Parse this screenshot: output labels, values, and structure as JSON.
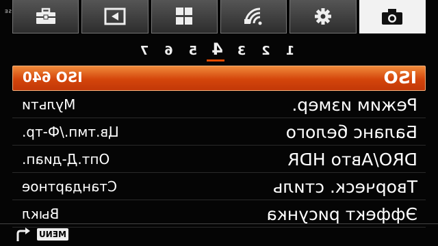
{
  "watermark": "LOVENSE",
  "tabs": [
    {
      "name": "shooting-tab",
      "icon": "camera-icon",
      "active": true
    },
    {
      "name": "custom-tab",
      "icon": "gear-icon",
      "active": false
    },
    {
      "name": "wireless-tab",
      "icon": "wireless-icon",
      "active": false
    },
    {
      "name": "apps-tab",
      "icon": "grid-icon",
      "active": false
    },
    {
      "name": "playback-tab",
      "icon": "playback-icon",
      "active": false
    },
    {
      "name": "setup-tab",
      "icon": "toolbox-icon",
      "active": false
    }
  ],
  "pages": [
    "1",
    "2",
    "3",
    "4",
    "5",
    "6",
    "7"
  ],
  "active_page": "4",
  "rows": [
    {
      "label": "ISO",
      "value": "ISO 640",
      "selected": true
    },
    {
      "label": "Режим измер.",
      "value": "Мульти",
      "selected": false
    },
    {
      "label": "Баланс белого",
      "value": "Цв.тмп./Ф-тр.",
      "selected": false
    },
    {
      "label": "DRO/Авто HDR",
      "value": "Опт.Д-диап.",
      "selected": false
    },
    {
      "label": "Творческ. стиль",
      "value": "Стандартное",
      "selected": false
    },
    {
      "label": "Эффект рисунка",
      "value": "Выкл",
      "selected": false
    }
  ],
  "footer": {
    "menu_label": "MENU",
    "back_icon": "return-arrow-icon"
  },
  "colors": {
    "accent": "#e24a00",
    "tab_active": "#f2f2f2",
    "background": "#050505"
  }
}
